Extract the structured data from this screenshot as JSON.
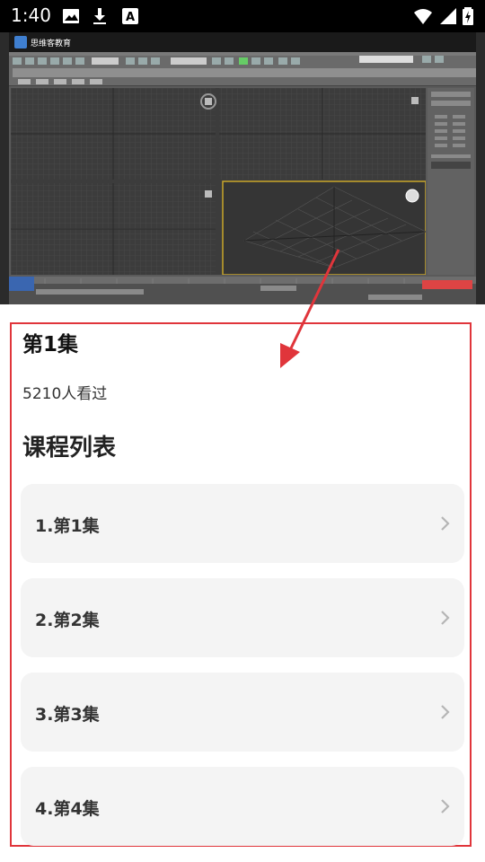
{
  "status_bar": {
    "time": "1:40",
    "icons": [
      "image-icon",
      "download-icon",
      "a-icon",
      "wifi-icon",
      "signal-icon",
      "battery-charging-icon"
    ]
  },
  "video": {
    "brand": "思维客教育",
    "software": "3ds Max"
  },
  "episode": {
    "title": "第1集",
    "views": "5210人看过"
  },
  "course_list": {
    "heading": "课程列表",
    "items": [
      {
        "label": "1.第1集"
      },
      {
        "label": "2.第2集"
      },
      {
        "label": "3.第3集"
      },
      {
        "label": "4.第4集"
      }
    ]
  },
  "colors": {
    "accent_red": "#e0353b",
    "item_bg": "#f4f4f4",
    "status_bar": "#000000"
  }
}
